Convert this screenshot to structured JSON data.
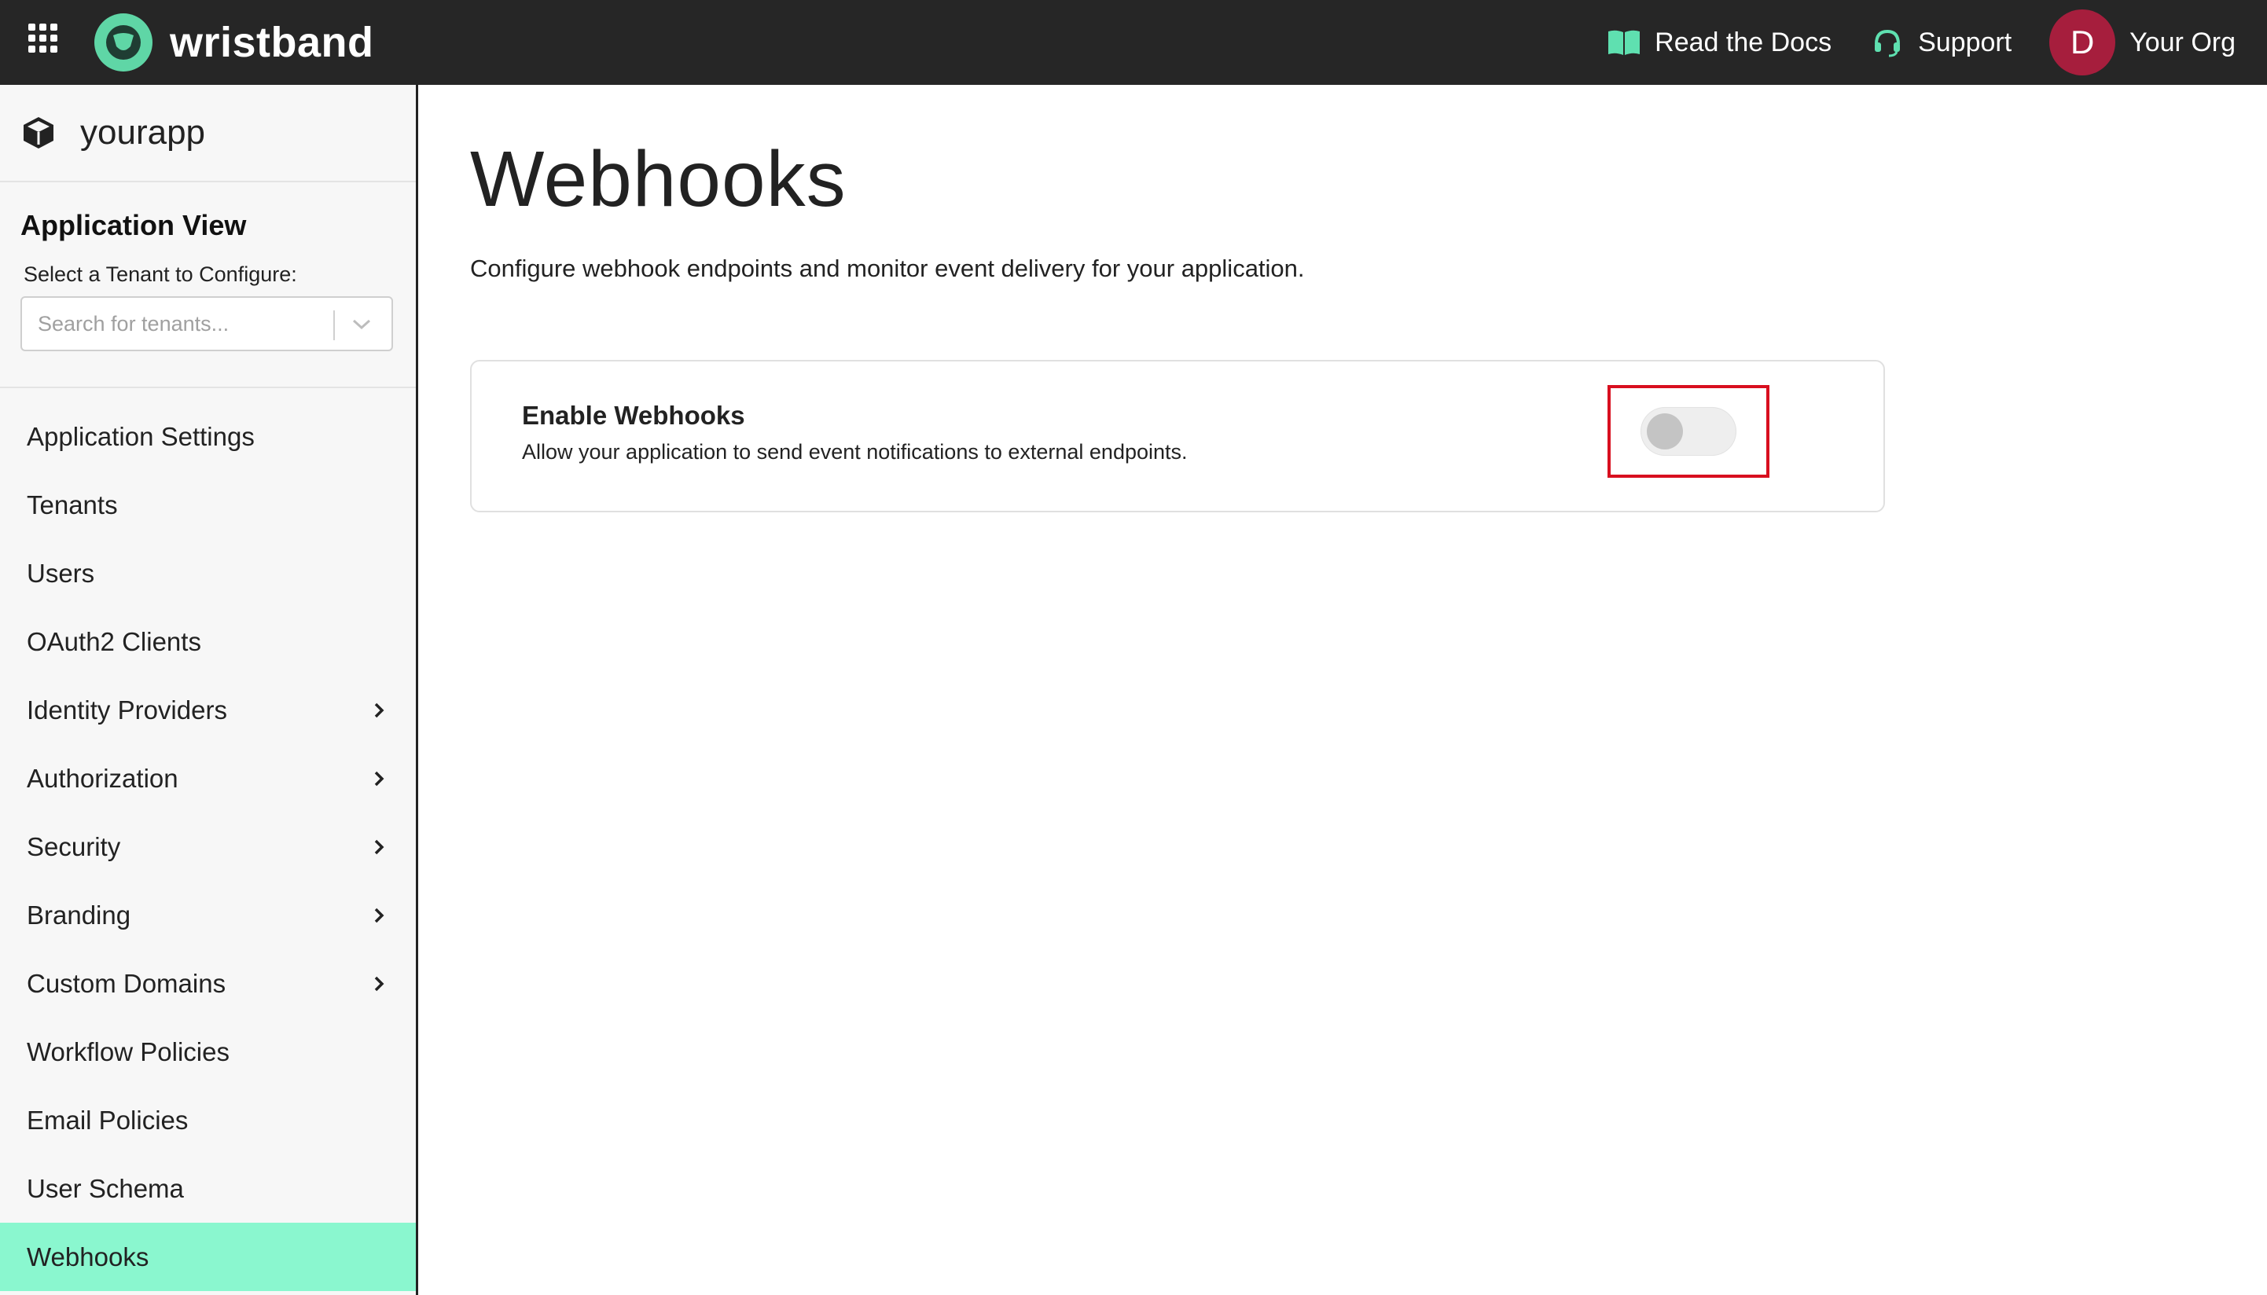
{
  "topbar": {
    "brand": "wristband",
    "docs_label": "Read the Docs",
    "support_label": "Support",
    "avatar_initial": "D",
    "org_name": "Your Org"
  },
  "sidebar": {
    "app_name": "yourapp",
    "section_title": "Application View",
    "tenant_label": "Select a Tenant to Configure:",
    "tenant_placeholder": "Search for tenants...",
    "items": [
      {
        "label": "Application Settings",
        "has_children": false
      },
      {
        "label": "Tenants",
        "has_children": false
      },
      {
        "label": "Users",
        "has_children": false
      },
      {
        "label": "OAuth2 Clients",
        "has_children": false
      },
      {
        "label": "Identity Providers",
        "has_children": true
      },
      {
        "label": "Authorization",
        "has_children": true
      },
      {
        "label": "Security",
        "has_children": true
      },
      {
        "label": "Branding",
        "has_children": true
      },
      {
        "label": "Custom Domains",
        "has_children": true
      },
      {
        "label": "Workflow Policies",
        "has_children": false
      },
      {
        "label": "Email Policies",
        "has_children": false
      },
      {
        "label": "User Schema",
        "has_children": false
      },
      {
        "label": "Webhooks",
        "has_children": false,
        "active": true
      }
    ]
  },
  "main": {
    "title": "Webhooks",
    "description": "Configure webhook endpoints and monitor event delivery for your application.",
    "card": {
      "title": "Enable Webhooks",
      "subtitle": "Allow your application to send event notifications to external endpoints.",
      "toggle_enabled": false
    }
  },
  "colors": {
    "topbar_bg": "#262626",
    "brand_green": "#5fd6a6",
    "active_nav": "#8af7cf",
    "avatar_bg": "#a61e3d",
    "highlight_box": "#d80f1f"
  }
}
